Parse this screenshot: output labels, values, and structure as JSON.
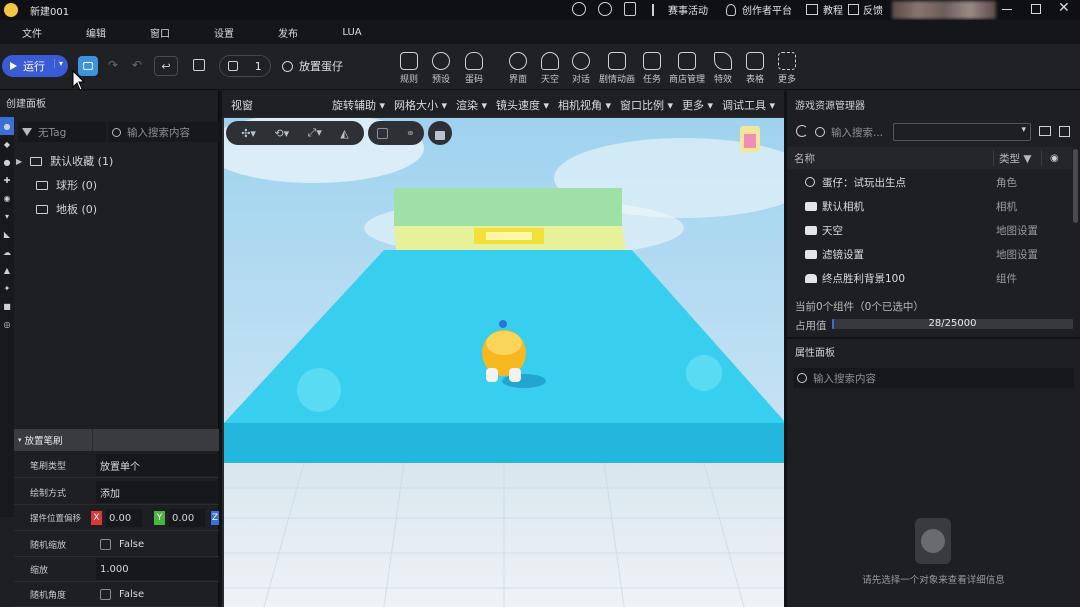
{
  "title_bar": {
    "doc_title": "新建001",
    "links": [
      "赛事活动",
      "创作者平台",
      "教程",
      "反馈"
    ]
  },
  "menu": [
    "文件",
    "编辑",
    "窗口",
    "设置",
    "发布",
    "LUA"
  ],
  "toolbar": {
    "run_label": "运行",
    "layer_value": "1",
    "place_egg_label": "放置蛋仔",
    "tools": [
      {
        "label": "规则",
        "icon": "rules-icon"
      },
      {
        "label": "预设",
        "icon": "preset-icon"
      },
      {
        "label": "蛋码",
        "icon": "egg-code-icon"
      },
      {
        "label": "界面",
        "icon": "ui-icon"
      },
      {
        "label": "天空",
        "icon": "sky-icon"
      },
      {
        "label": "对话",
        "icon": "dialog-icon"
      },
      {
        "label": "剧情动画",
        "icon": "story-animation-icon"
      },
      {
        "label": "任务",
        "icon": "task-icon"
      },
      {
        "label": "商店管理",
        "icon": "shop-icon"
      },
      {
        "label": "特效",
        "icon": "effect-icon"
      },
      {
        "label": "表格",
        "icon": "table-icon"
      },
      {
        "label": "更多",
        "icon": "more-grid-icon"
      }
    ]
  },
  "create_panel": {
    "title": "创建面板",
    "tag_placeholder": "无Tag",
    "search_placeholder": "输入搜索内容",
    "tree": [
      {
        "label": "默认收藏 (1)",
        "expandable": true
      },
      {
        "label": "球形 (0)",
        "expandable": false
      },
      {
        "label": "地板 (0)",
        "expandable": false
      }
    ]
  },
  "brush": {
    "section_title": "放置笔刷",
    "rows": [
      {
        "key": "笔刷类型",
        "value": "放置单个"
      },
      {
        "key": "绘制方式",
        "value": "添加"
      },
      {
        "key": "摆件位置偏移",
        "x": "0.00",
        "y": "0.00",
        "z": "Z"
      },
      {
        "key": "随机缩放",
        "value": "False"
      },
      {
        "key": "缩放",
        "value": "1.000"
      },
      {
        "key": "随机角度",
        "value": "False"
      }
    ]
  },
  "viewport": {
    "title": "视窗",
    "menus": [
      "旋转辅助",
      "网格大小",
      "渲染",
      "镜头速度",
      "相机视角",
      "窗口比例",
      "更多",
      "调试工具"
    ]
  },
  "resource_manager": {
    "title": "游戏资源管理器",
    "search_placeholder": "输入搜索...",
    "col_name": "名称",
    "col_type": "类型",
    "rows": [
      {
        "name": "蛋仔：试玩出生点",
        "type": "角色",
        "icon": "spawn-point-icon"
      },
      {
        "name": "默认相机",
        "type": "相机",
        "icon": "camera-icon"
      },
      {
        "name": "天空",
        "type": "地图设置",
        "icon": "camera-icon"
      },
      {
        "name": "滤镜设置",
        "type": "地图设置",
        "icon": "camera-icon"
      },
      {
        "name": "终点胜利背景100",
        "type": "组件",
        "icon": "component-icon"
      }
    ],
    "status": "当前0个组件（0个已选中）",
    "usage_label": "占用值",
    "usage_text": "28/25000",
    "usage_fraction": 0.0011
  },
  "property_panel": {
    "title": "属性面板",
    "search_placeholder": "输入搜索内容",
    "hint": "请先选择一个对象来查看详细信息"
  }
}
